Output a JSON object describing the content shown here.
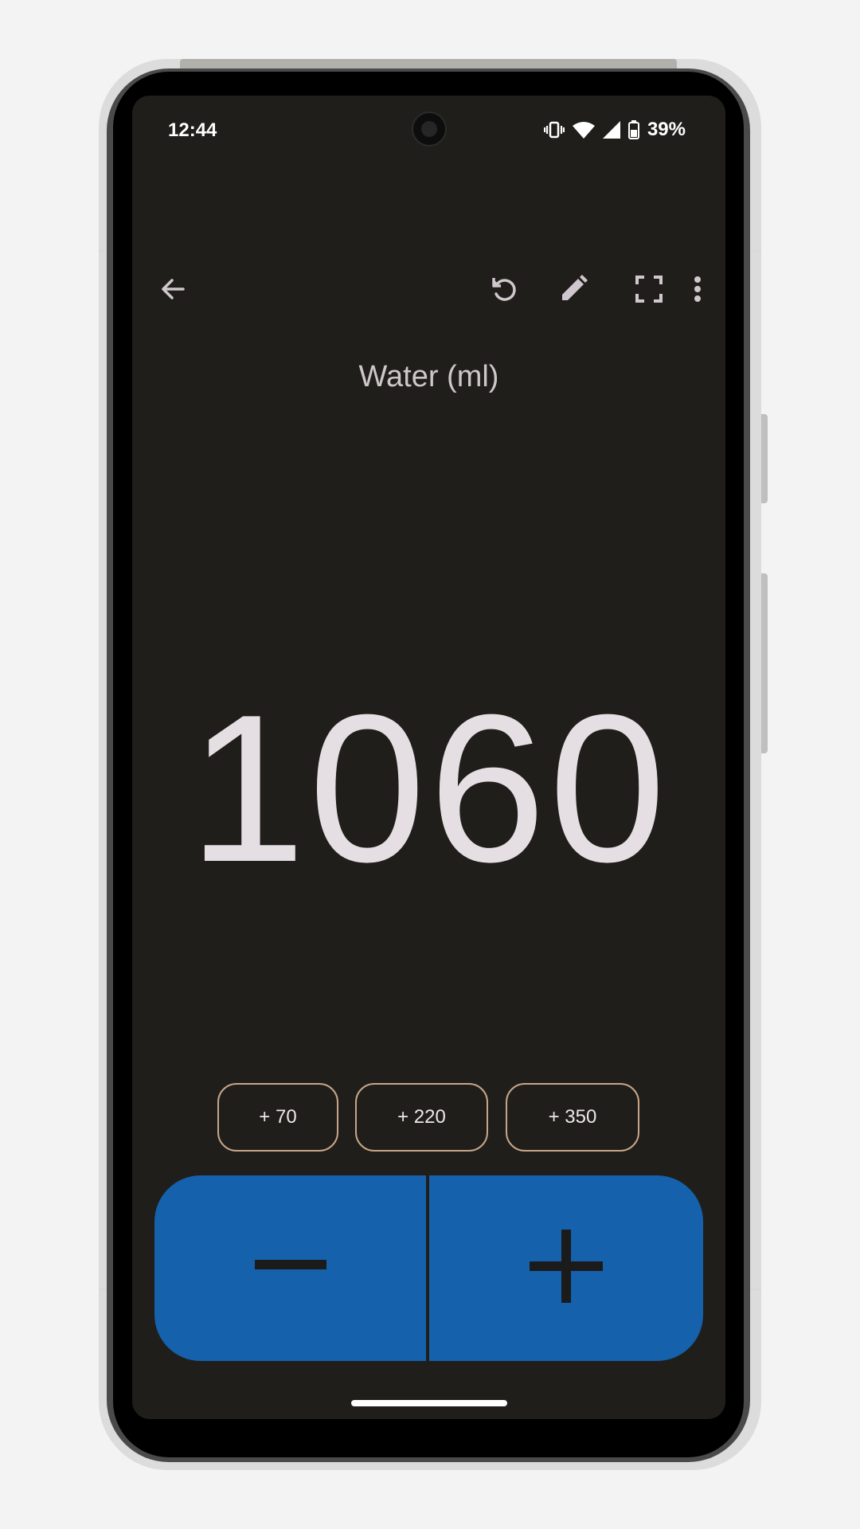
{
  "status_bar": {
    "time": "12:44",
    "battery": "39%",
    "icons": [
      "vibrate-icon",
      "wifi-icon",
      "signal-icon",
      "battery-icon"
    ]
  },
  "toolbar": {
    "back": "back-arrow-icon",
    "undo": "undo-icon",
    "edit": "edit-pencil-icon",
    "fullscreen": "fullscreen-icon",
    "more": "more-vert-icon"
  },
  "counter": {
    "title": "Water (ml)",
    "value": "1060"
  },
  "quick_add": [
    {
      "label": "+ 70"
    },
    {
      "label": "+ 220"
    },
    {
      "label": "+ 350"
    }
  ],
  "pad": {
    "decrement_icon": "minus-icon",
    "increment_icon": "plus-icon"
  },
  "colors": {
    "screen_bg": "#201e1a",
    "accent_blue": "#1561ac",
    "quick_border": "#c6a688",
    "text": "#e5dfe3"
  }
}
